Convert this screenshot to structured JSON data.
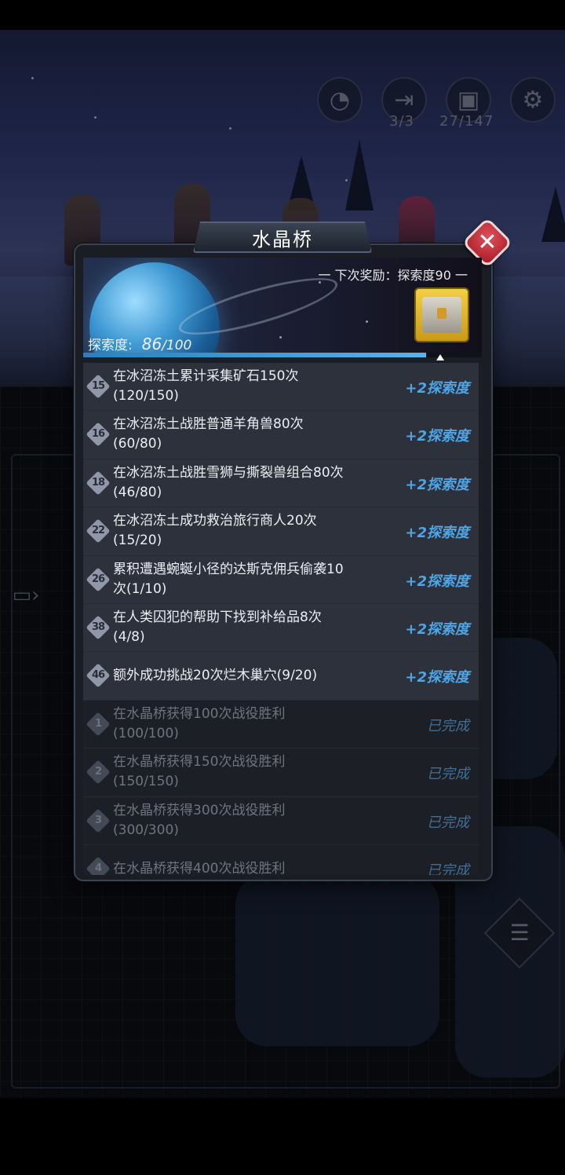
{
  "hud": {
    "explore_icon": "radar-icon",
    "door_icon": "door-icon",
    "door_count": "3/3",
    "chest_icon": "chest-icon",
    "chest_count": "27/147",
    "settings_icon": "gear-icon"
  },
  "modal": {
    "title": "水晶桥",
    "close_label": "✕",
    "next_reward": "一 下次奖励：探索度90 一",
    "explore_label": "探索度:",
    "explore_value": "86",
    "explore_max": "/100",
    "explore_progress": 0.86
  },
  "tasks": [
    {
      "num": "15",
      "line1": "在冰沼冻土累计采集矿石150次",
      "line2": "(120/150)",
      "reward": "+2探索度",
      "status": "active"
    },
    {
      "num": "16",
      "line1": "在冰沼冻土战胜普通羊角兽80次",
      "line2": "(60/80)",
      "reward": "+2探索度",
      "status": "active"
    },
    {
      "num": "18",
      "line1": "在冰沼冻土战胜雪狮与撕裂兽组合80次",
      "line2": "(46/80)",
      "reward": "+2探索度",
      "status": "active"
    },
    {
      "num": "22",
      "line1": "在冰沼冻土成功救治旅行商人20次",
      "line2": "(15/20)",
      "reward": "+2探索度",
      "status": "active"
    },
    {
      "num": "26",
      "line1": "累积遭遇蜿蜒小径的达斯克佣兵偷袭10",
      "line2": "次(1/10)",
      "reward": "+2探索度",
      "status": "active"
    },
    {
      "num": "38",
      "line1": "在人类囚犯的帮助下找到补给品8次",
      "line2": "(4/8)",
      "reward": "+2探索度",
      "status": "active"
    },
    {
      "num": "46",
      "line1": "额外成功挑战20次烂木巢穴(9/20)",
      "line2": "",
      "reward": "+2探索度",
      "status": "active"
    },
    {
      "num": "1",
      "line1": "在水晶桥获得100次战役胜利",
      "line2": "(100/100)",
      "reward": "已完成",
      "status": "done"
    },
    {
      "num": "2",
      "line1": "在水晶桥获得150次战役胜利",
      "line2": "(150/150)",
      "reward": "已完成",
      "status": "done"
    },
    {
      "num": "3",
      "line1": "在水晶桥获得300次战役胜利",
      "line2": "(300/300)",
      "reward": "已完成",
      "status": "done"
    },
    {
      "num": "4",
      "line1": "在水晶桥获得400次战役胜利",
      "line2": "",
      "reward": "已完成",
      "status": "done"
    }
  ],
  "side": {
    "chat_icon": "chat-icon",
    "quest_icon": "checklist-icon"
  }
}
